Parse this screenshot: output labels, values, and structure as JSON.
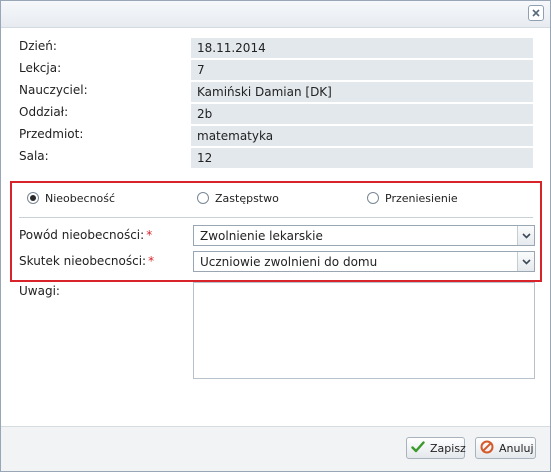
{
  "dialog": {
    "close_icon": "close-icon"
  },
  "info": {
    "rows": [
      {
        "label": "Dzień:",
        "value": "18.11.2014"
      },
      {
        "label": "Lekcja:",
        "value": "7"
      },
      {
        "label": "Nauczyciel:",
        "value": "Kamiński Damian [DK]"
      },
      {
        "label": "Oddział:",
        "value": "2b"
      },
      {
        "label": "Przedmiot:",
        "value": "matematyka"
      },
      {
        "label": "Sala:",
        "value": "12"
      }
    ]
  },
  "type_options": {
    "selected": "Nieobecność",
    "items": [
      {
        "label": "Nieobecność",
        "checked": true
      },
      {
        "label": "Zastępstwo",
        "checked": false
      },
      {
        "label": "Przeniesienie",
        "checked": false
      }
    ]
  },
  "form": {
    "reason_label": "Powód nieobecności:",
    "reason_value": "Zwolnienie lekarskie",
    "effect_label": "Skutek nieobecności:",
    "effect_value": "Uczniowie zwolnieni do domu",
    "required_mark": "*",
    "notes_label": "Uwagi:",
    "notes_value": ""
  },
  "footer": {
    "save_label": "Zapisz",
    "cancel_label": "Anuluj"
  },
  "colors": {
    "highlight_border": "#d8232a",
    "save_icon": "#3a9a2a",
    "cancel_icon": "#d45a2a"
  }
}
